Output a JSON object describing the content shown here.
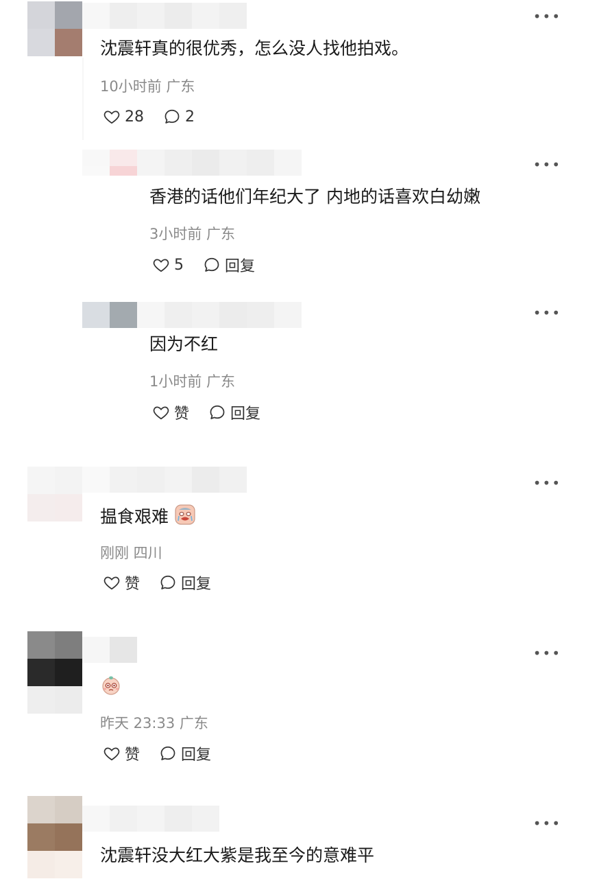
{
  "comments": [
    {
      "text": "沈震轩真的很优秀，怎么没人找他拍戏。",
      "meta": "10小时前 广东",
      "likes": "28",
      "replies": "2"
    },
    {
      "text": "揾食艰难",
      "meta": "刚刚 四川",
      "likes": "赞",
      "replies": "回复",
      "emoji": "crying-face-sticker"
    },
    {
      "text": "",
      "meta": "昨天 23:33 广东",
      "likes": "赞",
      "replies": "回复",
      "emoji": "pleading-face-sticker"
    },
    {
      "text": "沈震轩没大红大紫是我至今的意难平"
    }
  ],
  "replies": [
    {
      "text": "香港的话他们年纪大了 内地的话喜欢白幼嫩",
      "meta": "3小时前 广东",
      "likes": "5",
      "replies": "回复"
    },
    {
      "text": "因为不红",
      "meta": "1小时前 广东",
      "likes": "赞",
      "replies": "回复"
    }
  ],
  "more_icon": "•••",
  "colors": {
    "meta": "#8a8a8a",
    "text": "#1a1a1a",
    "icon": "#333333"
  }
}
